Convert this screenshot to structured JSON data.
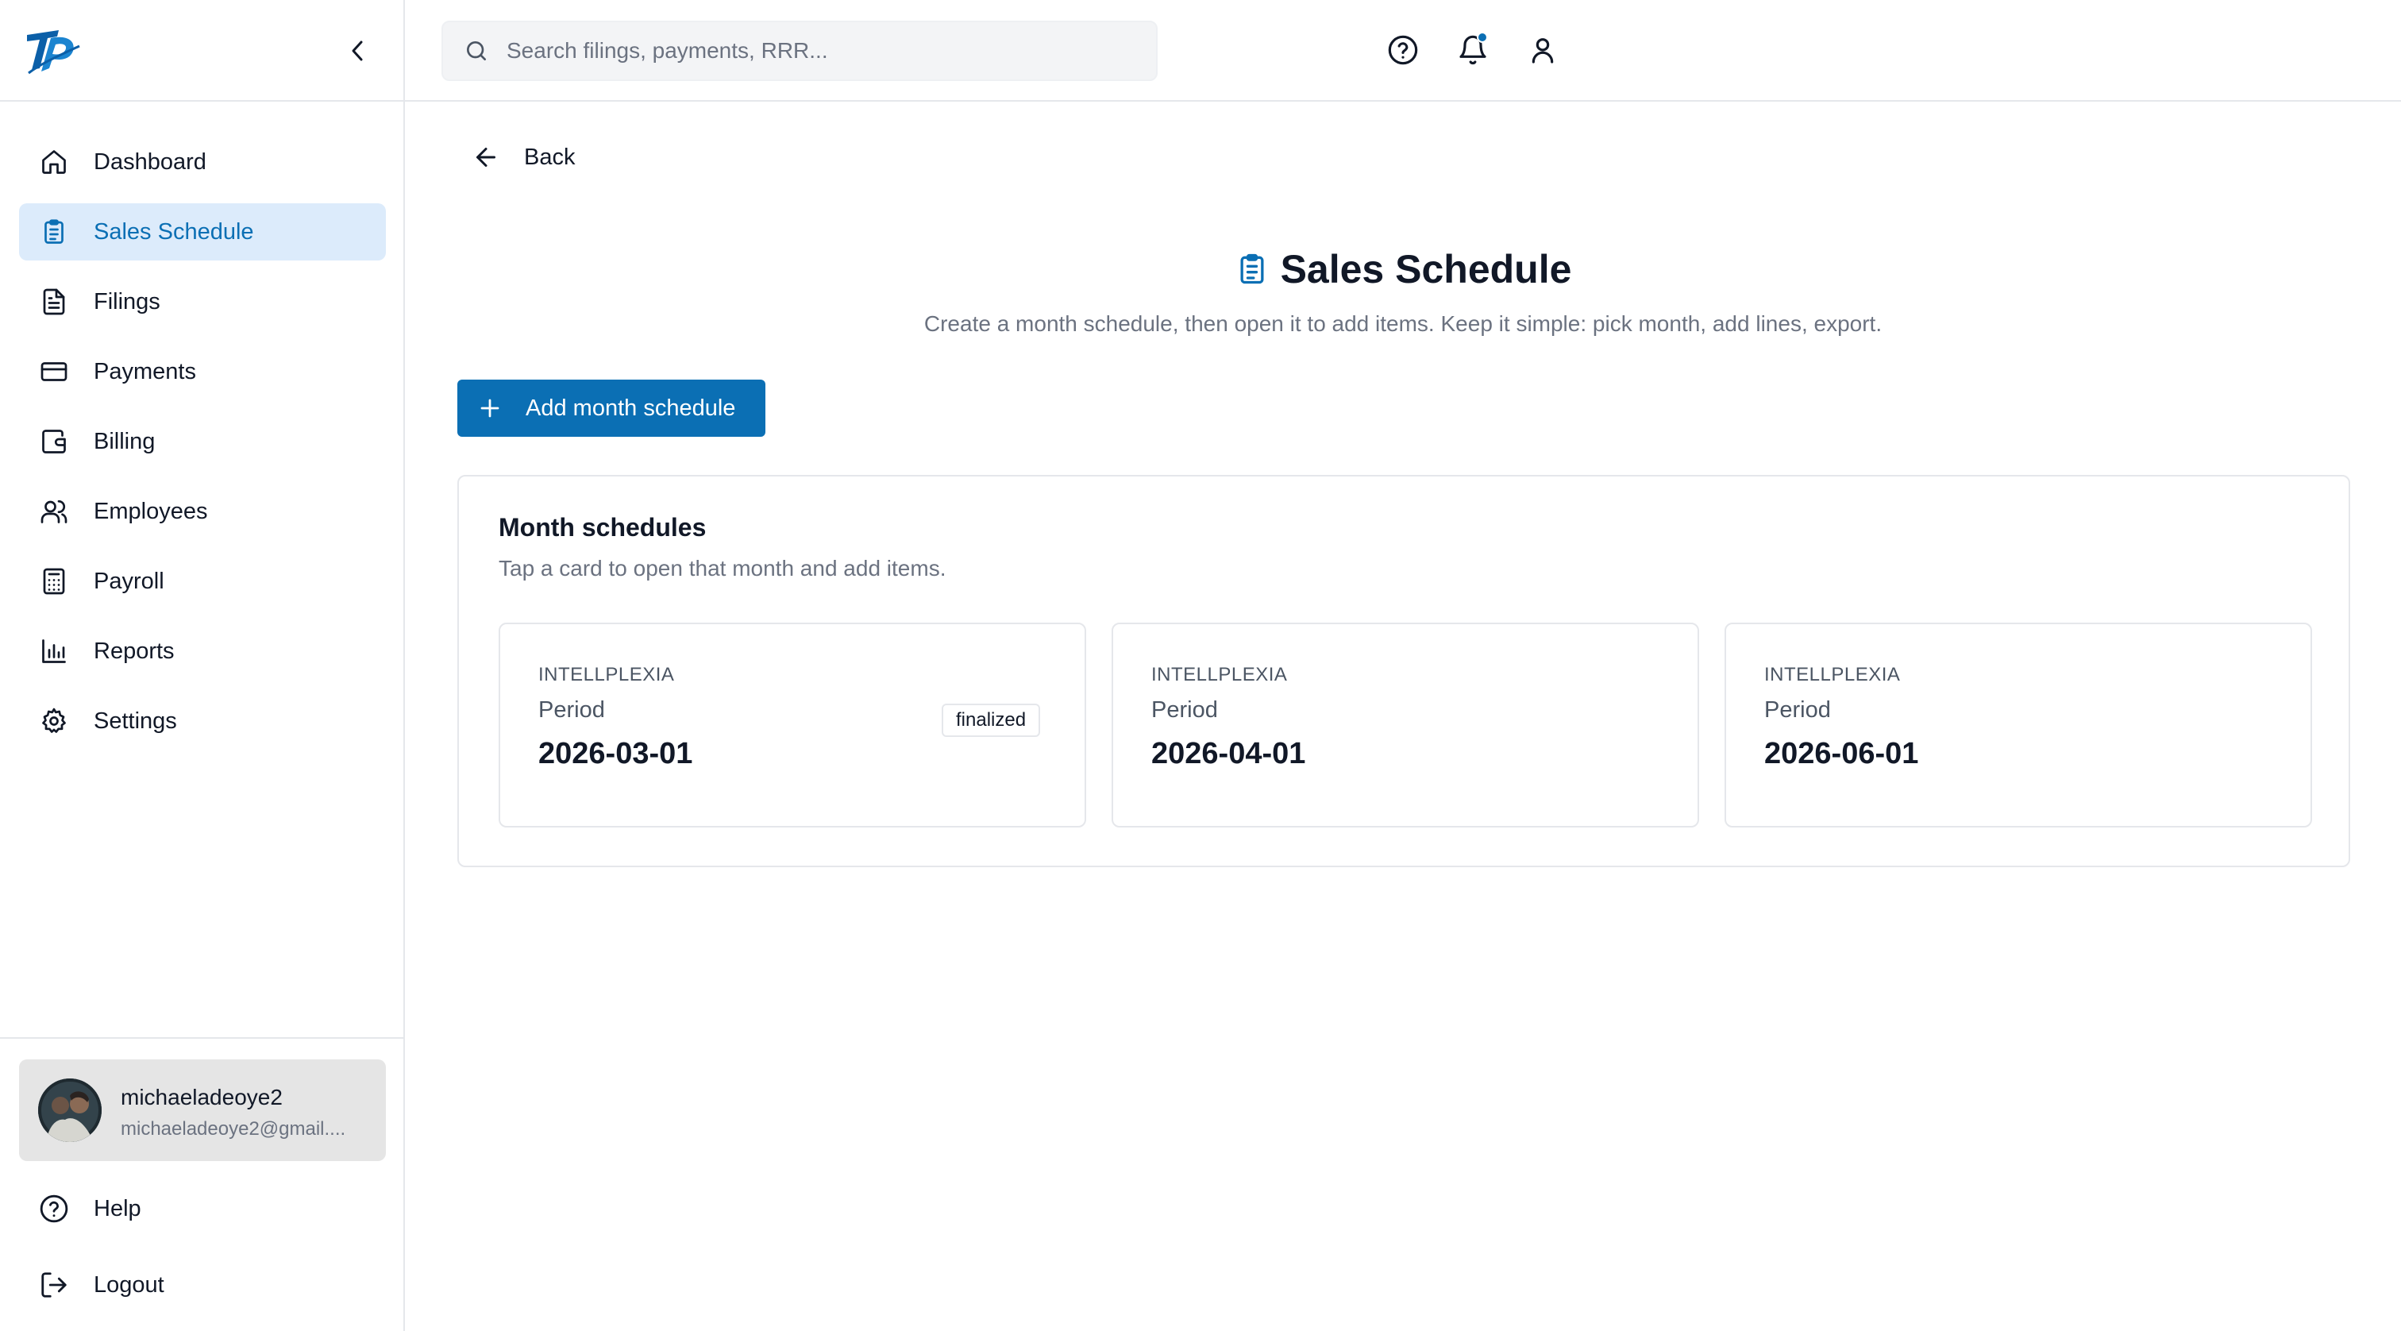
{
  "colors": {
    "accent": "#0b6fb4",
    "active_bg": "#dcebfb",
    "notification_dot": "#0b6fb4"
  },
  "sidebar": {
    "items": [
      {
        "label": "Dashboard",
        "icon": "home-icon"
      },
      {
        "label": "Sales Schedule",
        "icon": "clipboard-icon",
        "active": true
      },
      {
        "label": "Filings",
        "icon": "file-text-icon"
      },
      {
        "label": "Payments",
        "icon": "credit-card-icon"
      },
      {
        "label": "Billing",
        "icon": "wallet-icon"
      },
      {
        "label": "Employees",
        "icon": "users-icon"
      },
      {
        "label": "Payroll",
        "icon": "calculator-icon"
      },
      {
        "label": "Reports",
        "icon": "bar-chart-icon"
      },
      {
        "label": "Settings",
        "icon": "gear-icon"
      }
    ],
    "user": {
      "name": "michaeladeoye2",
      "email": "michaeladeoye2@gmail...."
    },
    "footer": {
      "help_label": "Help",
      "logout_label": "Logout"
    }
  },
  "topbar": {
    "search_placeholder": "Search filings, payments, RRR..."
  },
  "main": {
    "back_label": "Back",
    "title": "Sales Schedule",
    "subtitle": "Create a month schedule, then open it to add items. Keep it simple: pick month, add lines, export.",
    "add_button_label": "Add month schedule",
    "panel": {
      "title": "Month schedules",
      "subtitle": "Tap a card to open that month and add items.",
      "cards": [
        {
          "org": "INTELLPLEXIA",
          "period_label": "Period",
          "date": "2026-03-01",
          "badge": "finalized"
        },
        {
          "org": "INTELLPLEXIA",
          "period_label": "Period",
          "date": "2026-04-01"
        },
        {
          "org": "INTELLPLEXIA",
          "period_label": "Period",
          "date": "2026-06-01"
        }
      ]
    }
  }
}
